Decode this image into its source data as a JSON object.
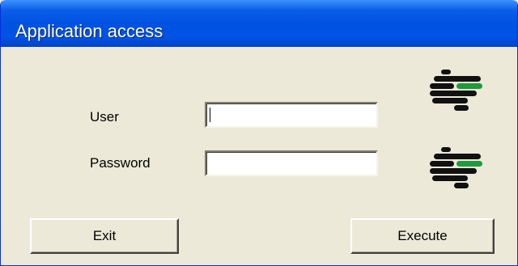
{
  "window": {
    "title": "Application access"
  },
  "form": {
    "user_label": "User",
    "user_value": "",
    "password_label": "Password",
    "password_value": ""
  },
  "buttons": {
    "exit_label": "Exit",
    "execute_label": "Execute"
  },
  "icons": [
    "app-logo-icon",
    "app-logo-icon"
  ],
  "colors": {
    "titlebar": "#0052e0",
    "window_bg": "#ece9d8",
    "logo_accent": "#1f9a3c"
  }
}
